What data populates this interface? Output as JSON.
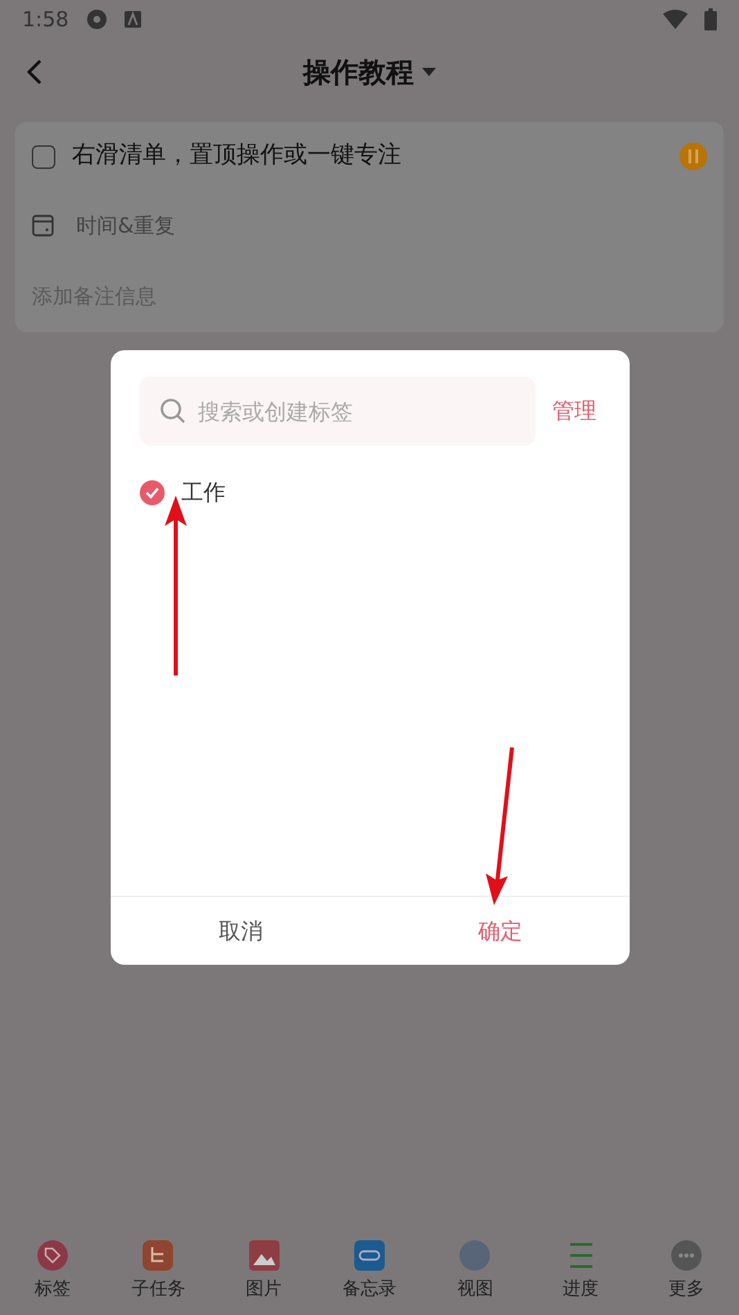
{
  "status_bar": {
    "time": "1:58"
  },
  "header": {
    "title": "操作教程"
  },
  "task": {
    "checked": false,
    "title": "右滑清单，置顶操作或一键专注",
    "time_label": "时间&重复",
    "note_placeholder": "添加备注信息"
  },
  "tag_dialog": {
    "search": {
      "placeholder": "搜索或创建标签"
    },
    "manage": "管理",
    "tags": [
      {
        "label": "工作",
        "checked": true
      }
    ],
    "buttons": [
      {
        "label": "取消",
        "kind": "cancel"
      },
      {
        "label": "确定",
        "kind": "confirm"
      }
    ]
  },
  "toolbar": [
    {
      "label": "标签",
      "kind": "tag"
    },
    {
      "label": "子任务",
      "kind": "subtask"
    },
    {
      "label": "图片",
      "kind": "image"
    },
    {
      "label": "备忘录",
      "kind": "memo"
    },
    {
      "label": "视图",
      "kind": "view"
    },
    {
      "label": "进度",
      "kind": "progress"
    },
    {
      "label": "更多",
      "kind": "more"
    }
  ]
}
